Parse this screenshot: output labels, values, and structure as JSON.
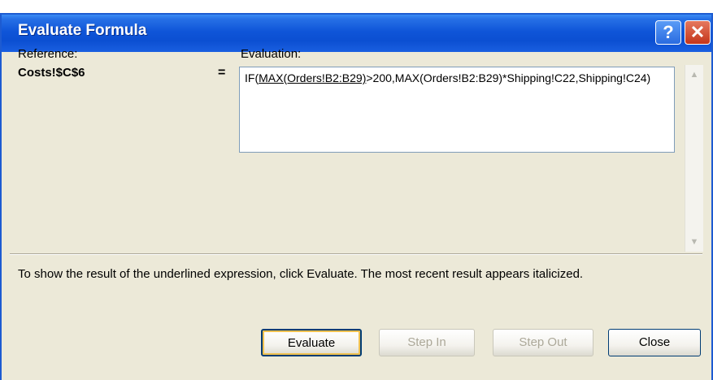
{
  "window": {
    "title": "Evaluate Formula",
    "help_glyph": "?",
    "close_glyph": "✕"
  },
  "reference": {
    "label": "Reference:",
    "value": "Costs!$C$6"
  },
  "evaluation": {
    "label": "Evaluation:",
    "equals": "=",
    "formula_prefix": "IF(",
    "formula_underlined": "MAX(Orders!B2:B29)",
    "formula_suffix": ">200,MAX(Orders!B2:B29)*Shipping!C22,Shipping!C24)"
  },
  "info_text": "To show the result of the underlined expression, click Evaluate.  The most recent result appears italicized.",
  "buttons": {
    "evaluate": "Evaluate",
    "step_in": "Step In",
    "step_out": "Step Out",
    "close": "Close"
  },
  "colors": {
    "titlebar": "#0b4fd2",
    "dialog_bg": "#ece9d8",
    "close_red": "#c4351a"
  }
}
